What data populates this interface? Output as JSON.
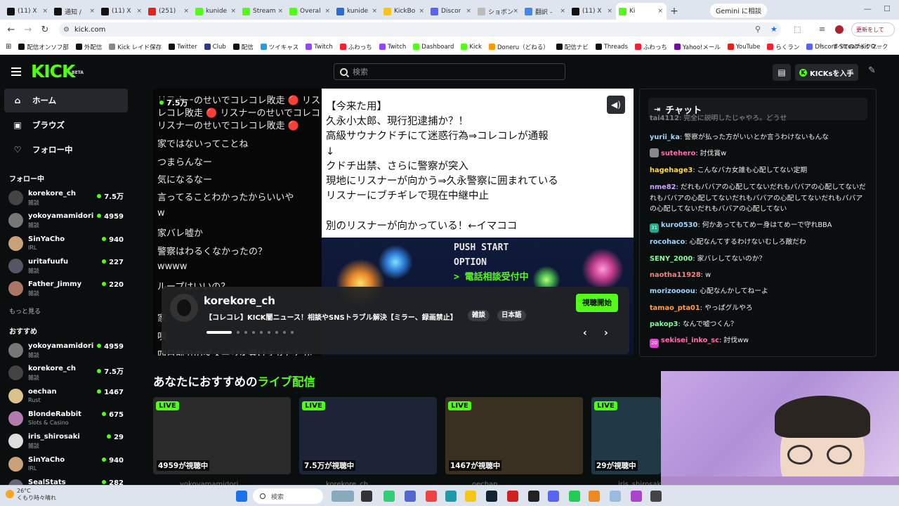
{
  "browser": {
    "tabs": [
      {
        "label": "(11) X",
        "color": "#111"
      },
      {
        "label": "通知 /",
        "color": "#111"
      },
      {
        "label": "(11) X",
        "color": "#111"
      },
      {
        "label": "(251)",
        "color": "#e62117"
      },
      {
        "label": "kunide",
        "color": "#53fc18"
      },
      {
        "label": "Stream",
        "color": "#53fc18"
      },
      {
        "label": "Overal",
        "color": "#53fc18"
      },
      {
        "label": "kunide",
        "color": "#2b6bd6"
      },
      {
        "label": "KickBo",
        "color": "#f5c518"
      },
      {
        "label": "Discor",
        "color": "#5865f2"
      },
      {
        "label": "ショボン",
        "color": "#bbb"
      },
      {
        "label": "翻訳 -",
        "color": "#4285f4"
      },
      {
        "label": "(11) X",
        "color": "#111"
      },
      {
        "label": "Ki",
        "color": "#53fc18",
        "active": true
      }
    ],
    "new_tab": "+",
    "gemini_button": "Gemini に相談",
    "url": "kick.com",
    "profile_label": "更新をして",
    "bookmarks": [
      {
        "label": "配信オンソフ部",
        "color": "#111"
      },
      {
        "label": "外配信",
        "color": "#111"
      },
      {
        "label": "Kick レイド保存",
        "color": "#888"
      },
      {
        "label": "Twitter",
        "color": "#111"
      },
      {
        "label": "Club",
        "color": "#2b3a8c"
      },
      {
        "label": "配信",
        "color": "#111"
      },
      {
        "label": "ツイキャス",
        "color": "#2b9be0"
      },
      {
        "label": "Twitch",
        "color": "#9146ff"
      },
      {
        "label": "ふわっち",
        "color": "#e23"
      },
      {
        "label": "Twitch",
        "color": "#9146ff"
      },
      {
        "label": "Dashboard",
        "color": "#53fc18"
      },
      {
        "label": "Kick",
        "color": "#53fc18"
      },
      {
        "label": "Doneru（どねる）",
        "color": "#f90"
      },
      {
        "label": "配信ナビ",
        "color": "#111"
      },
      {
        "label": "Threads",
        "color": "#111"
      },
      {
        "label": "ふわっち",
        "color": "#e23"
      },
      {
        "label": "Yahoo!メール",
        "color": "#720e9e"
      },
      {
        "label": "YouTube",
        "color": "#e62117"
      },
      {
        "label": "らくラン",
        "color": "#e23"
      },
      {
        "label": "Discord StreamKit O...",
        "color": "#5865f2"
      }
    ],
    "all_bookmarks": "すべてのブックマーク"
  },
  "kick": {
    "logo": "KICK",
    "logo_beta": "BETA",
    "search_placeholder": "検索",
    "get_kicks": "KICKsを入手",
    "nav": [
      {
        "label": "ホーム",
        "icon": "home-icon",
        "active": true
      },
      {
        "label": "ブラウズ",
        "icon": "browse-icon"
      },
      {
        "label": "フォロー中",
        "icon": "heart-icon"
      }
    ],
    "following_title": "フォロー中",
    "following": [
      {
        "name": "korekore_ch",
        "category": "雑談",
        "viewers": "7.5万",
        "color": "#444"
      },
      {
        "name": "yokoyamamidori",
        "category": "雑談",
        "viewers": "4959",
        "color": "#777"
      },
      {
        "name": "SinYaCho",
        "category": "IRL",
        "viewers": "940",
        "color": "#c9a27a"
      },
      {
        "name": "uritafuufu",
        "category": "雑談",
        "viewers": "227",
        "color": "#556"
      },
      {
        "name": "Father_Jimmy",
        "category": "雑談",
        "viewers": "220",
        "color": "#a76"
      }
    ],
    "show_more": "もっと見る",
    "recommended_title": "おすすめ",
    "recommended": [
      {
        "name": "yokoyamamidori",
        "category": "雑談",
        "viewers": "4959",
        "color": "#777"
      },
      {
        "name": "korekore_ch",
        "category": "雑談",
        "viewers": "7.5万",
        "color": "#444"
      },
      {
        "name": "oechan",
        "category": "Rust",
        "viewers": "1467",
        "color": "#d9c38a"
      },
      {
        "name": "BlondeRabbit",
        "category": "Slots & Casino",
        "viewers": "675",
        "color": "#b37ab0"
      },
      {
        "name": "iris_shirosaki",
        "category": "雑談",
        "viewers": "29",
        "color": "#ddd"
      },
      {
        "name": "SinYaCho",
        "category": "IRL",
        "viewers": "940",
        "color": "#c9a27a"
      },
      {
        "name": "SealStats",
        "category": "",
        "viewers": "282",
        "color": "#667"
      }
    ]
  },
  "hero": {
    "viewer_badge": "7.5万",
    "left_lines": [
      "リスナーのせいでコレコレ敗走 🔴 リス",
      "レコレ敗走 🔴 リスナーのせいでコレコ",
      "リスナーのせいでコレコレ敗走 🔴",
      "家ではないってことね",
      "つまらんなー",
      "気になるなー",
      "言ってることわかったからいいや",
      "w",
      "家バレ嘘か",
      "警察はわるくなかったの？",
      "wwww",
      "ループはいいの？",
      "家",
      "唄",
      "四日前分のダメージを受けませたとか"
    ],
    "announce_lines": [
      "【今来た用】",
      "久永小太郎、現行犯逮捕か？！",
      "高級サウナクドチにて迷惑行為⇒コレコレが通報",
      "↓",
      "クドチ出禁、さらに警察が突入",
      "現地にリスナーが向かう⇒久永警察に囲まれている",
      "リスナーにブチギレで現在中継中止",
      "",
      "別のリスナーが向かっている！←イマココ"
    ],
    "game_menu": [
      "PUSH START",
      "OPTION",
      "> 電話相談受付中"
    ],
    "streamer": "korekore_ch",
    "title": "【コレコレ】KICK闇ニュース！相談やSNSトラブル解決【ミラー、録画禁止】",
    "tags": [
      "雑談",
      "日本語"
    ],
    "watch_button": "視聴開始",
    "carousel_count": 9
  },
  "chat": {
    "title": "チャット",
    "messages": [
      {
        "user": "tai4112",
        "text": "完全に説明したじゃやろ。どうせ",
        "color": "#cfcfcf"
      },
      {
        "user": "yurii_ka",
        "text": "警察が払った方がいいとか言うわけないもんな",
        "color": "#9fd7ff"
      },
      {
        "user": "sutehero",
        "text": "討伐賞w",
        "color": "#ff6fb0",
        "badge": "#888",
        "badge_text": ""
      },
      {
        "user": "hagehage3",
        "text": "こんなバカ女誰も心配してない定期",
        "color": "#ffd84d"
      },
      {
        "user": "nme82",
        "text": "だれもババアの心配してないだれもババアの心配してないだれもババアの心配してないだれもババアの心配してないだれもババアの心配してないだれもババアの心配してない",
        "color": "#c9a6ff"
      },
      {
        "user": "kuro0530",
        "text": "何かあってもてめー身はてめーで守れBBA",
        "color": "#9fd7ff",
        "badge": "#2a8",
        "badge_text": "31"
      },
      {
        "user": "rocohaco",
        "text": "心配なんてするわけないむしろ敵だわ",
        "color": "#9fd7ff"
      },
      {
        "user": "SENY_2000",
        "text": "家バレしてないのか？",
        "color": "#7fff9a"
      },
      {
        "user": "naotha11928",
        "text": "w",
        "color": "#ff7f7f"
      },
      {
        "user": "morizoooou",
        "text": "心配なんかしてねーよ",
        "color": "#9fd7ff"
      },
      {
        "user": "tamao_pta01",
        "text": "やっぱグルやろ",
        "color": "#ff9f4d"
      },
      {
        "user": "pakop3",
        "text": "なんで嘘つくん？",
        "color": "#7fff9a"
      },
      {
        "user": "sekisei_inko_sc",
        "text": "討伐ww",
        "color": "#ff6fb0",
        "badge": "#d4c",
        "badge_text": "20"
      }
    ]
  },
  "recommended_live": {
    "title_prefix": "あなたにおすすめの",
    "title_highlight": "ライブ配信",
    "live_label": "LIVE",
    "cards": [
      {
        "viewers": "4959が視聴中",
        "name": "yokoyamamidori",
        "bg": "#2a2a2a"
      },
      {
        "viewers": "7.5万が視聴中",
        "name": "korekore_ch",
        "bg": "#1d2436"
      },
      {
        "viewers": "1467が視聴中",
        "name": "oechan",
        "bg": "#3a3022"
      },
      {
        "viewers": "29が視聴中",
        "name": "iris_shirosaki",
        "bg": "#1f3a44"
      }
    ]
  },
  "taskbar": {
    "temperature": "26°C",
    "weather": "くもり時々晴れ",
    "search": "検索"
  }
}
